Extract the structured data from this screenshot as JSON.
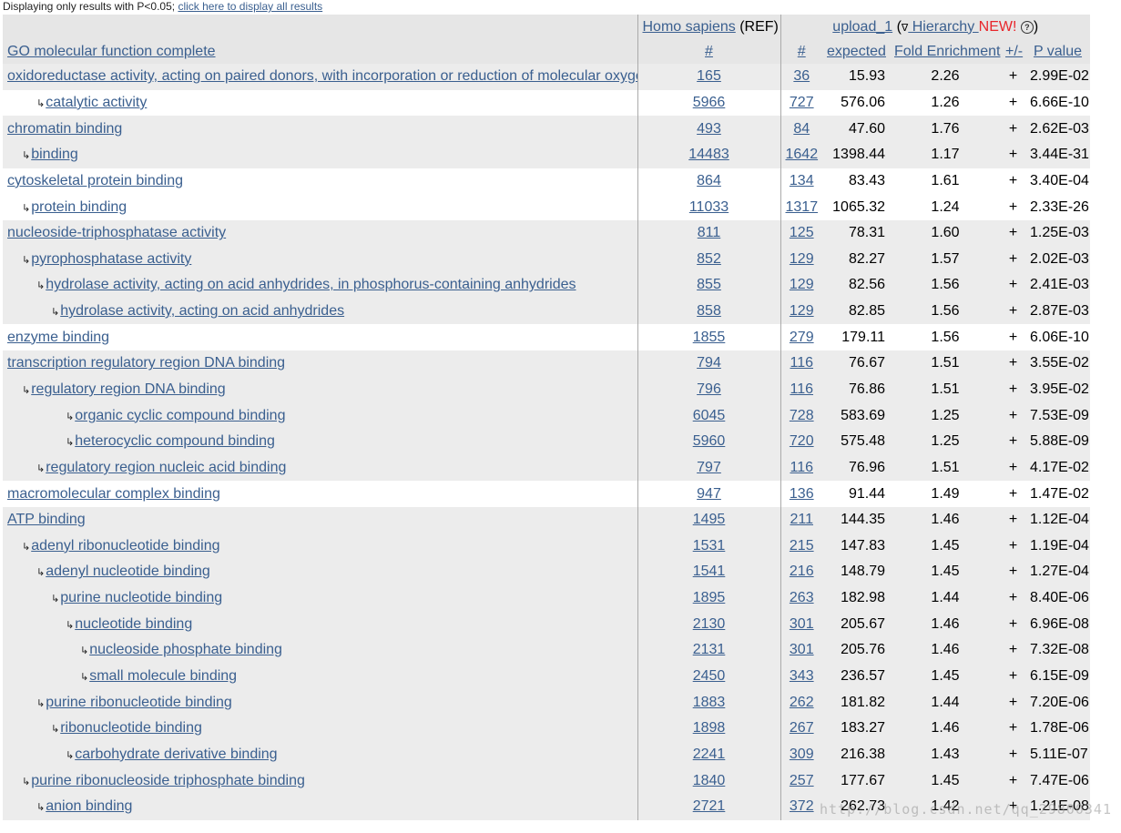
{
  "notice": {
    "text": "Displaying only results with P<0.05; ",
    "link": "click here to display all results"
  },
  "header": {
    "ref_species": "Homo sapiens",
    "ref_suffix": " (REF)",
    "upload": "upload_1",
    "hierarchy_open": " (",
    "hierarchy_tri": "∇",
    "hierarchy_link": " Hierarchy ",
    "new_label": "NEW!",
    "help_icon": "?",
    "hierarchy_close": ")",
    "go_column": "GO molecular function complete",
    "ref_count": "#",
    "count": "#",
    "expected": "expected",
    "fold": "Fold Enrichment",
    "plusminus": "+/-",
    "pvalue": "P value"
  },
  "arrow_glyph": "↳",
  "watermark": "http://blog.csdn.net/qq_29800341",
  "rows": [
    {
      "indent": 0,
      "term": "oxidoreductase activity, acting on paired donors, with incorporation or reduction of molecular oxygen",
      "ref": "165",
      "count": "36",
      "expected": "15.93",
      "fold": "2.26",
      "pm": "+",
      "p": "2.99E-02",
      "shade": true
    },
    {
      "indent": 2,
      "term": "catalytic activity",
      "ref": "5966",
      "count": "727",
      "expected": "576.06",
      "fold": "1.26",
      "pm": "+",
      "p": "6.66E-10",
      "shade": false
    },
    {
      "indent": 0,
      "term": "chromatin binding",
      "ref": "493",
      "count": "84",
      "expected": "47.60",
      "fold": "1.76",
      "pm": "+",
      "p": "2.62E-03",
      "shade": true
    },
    {
      "indent": 1,
      "term": "binding",
      "ref": "14483",
      "count": "1642",
      "expected": "1398.44",
      "fold": "1.17",
      "pm": "+",
      "p": "3.44E-31",
      "shade": true
    },
    {
      "indent": 0,
      "term": "cytoskeletal protein binding",
      "ref": "864",
      "count": "134",
      "expected": "83.43",
      "fold": "1.61",
      "pm": "+",
      "p": "3.40E-04",
      "shade": false
    },
    {
      "indent": 1,
      "term": "protein binding",
      "ref": "11033",
      "count": "1317",
      "expected": "1065.32",
      "fold": "1.24",
      "pm": "+",
      "p": "2.33E-26",
      "shade": false
    },
    {
      "indent": 0,
      "term": "nucleoside-triphosphatase activity",
      "ref": "811",
      "count": "125",
      "expected": "78.31",
      "fold": "1.60",
      "pm": "+",
      "p": "1.25E-03",
      "shade": true
    },
    {
      "indent": 1,
      "term": "pyrophosphatase activity",
      "ref": "852",
      "count": "129",
      "expected": "82.27",
      "fold": "1.57",
      "pm": "+",
      "p": "2.02E-03",
      "shade": true
    },
    {
      "indent": 2,
      "term": "hydrolase activity, acting on acid anhydrides, in phosphorus-containing anhydrides",
      "ref": "855",
      "count": "129",
      "expected": "82.56",
      "fold": "1.56",
      "pm": "+",
      "p": "2.41E-03",
      "shade": true
    },
    {
      "indent": 3,
      "term": "hydrolase activity, acting on acid anhydrides",
      "ref": "858",
      "count": "129",
      "expected": "82.85",
      "fold": "1.56",
      "pm": "+",
      "p": "2.87E-03",
      "shade": true
    },
    {
      "indent": 0,
      "term": "enzyme binding",
      "ref": "1855",
      "count": "279",
      "expected": "179.11",
      "fold": "1.56",
      "pm": "+",
      "p": "6.06E-10",
      "shade": false
    },
    {
      "indent": 0,
      "term": "transcription regulatory region DNA binding",
      "ref": "794",
      "count": "116",
      "expected": "76.67",
      "fold": "1.51",
      "pm": "+",
      "p": "3.55E-02",
      "shade": true
    },
    {
      "indent": 1,
      "term": "regulatory region DNA binding",
      "ref": "796",
      "count": "116",
      "expected": "76.86",
      "fold": "1.51",
      "pm": "+",
      "p": "3.95E-02",
      "shade": true
    },
    {
      "indent": 4,
      "term": "organic cyclic compound binding",
      "ref": "6045",
      "count": "728",
      "expected": "583.69",
      "fold": "1.25",
      "pm": "+",
      "p": "7.53E-09",
      "shade": true
    },
    {
      "indent": 4,
      "term": "heterocyclic compound binding",
      "ref": "5960",
      "count": "720",
      "expected": "575.48",
      "fold": "1.25",
      "pm": "+",
      "p": "5.88E-09",
      "shade": true
    },
    {
      "indent": 2,
      "term": "regulatory region nucleic acid binding",
      "ref": "797",
      "count": "116",
      "expected": "76.96",
      "fold": "1.51",
      "pm": "+",
      "p": "4.17E-02",
      "shade": true
    },
    {
      "indent": 0,
      "term": "macromolecular complex binding",
      "ref": "947",
      "count": "136",
      "expected": "91.44",
      "fold": "1.49",
      "pm": "+",
      "p": "1.47E-02",
      "shade": false
    },
    {
      "indent": 0,
      "term": "ATP binding",
      "ref": "1495",
      "count": "211",
      "expected": "144.35",
      "fold": "1.46",
      "pm": "+",
      "p": "1.12E-04",
      "shade": true
    },
    {
      "indent": 1,
      "term": "adenyl ribonucleotide binding",
      "ref": "1531",
      "count": "215",
      "expected": "147.83",
      "fold": "1.45",
      "pm": "+",
      "p": "1.19E-04",
      "shade": true
    },
    {
      "indent": 2,
      "term": "adenyl nucleotide binding",
      "ref": "1541",
      "count": "216",
      "expected": "148.79",
      "fold": "1.45",
      "pm": "+",
      "p": "1.27E-04",
      "shade": true
    },
    {
      "indent": 3,
      "term": "purine nucleotide binding",
      "ref": "1895",
      "count": "263",
      "expected": "182.98",
      "fold": "1.44",
      "pm": "+",
      "p": "8.40E-06",
      "shade": true
    },
    {
      "indent": 4,
      "term": "nucleotide binding",
      "ref": "2130",
      "count": "301",
      "expected": "205.67",
      "fold": "1.46",
      "pm": "+",
      "p": "6.96E-08",
      "shade": true
    },
    {
      "indent": 5,
      "term": "nucleoside phosphate binding",
      "ref": "2131",
      "count": "301",
      "expected": "205.76",
      "fold": "1.46",
      "pm": "+",
      "p": "7.32E-08",
      "shade": true
    },
    {
      "indent": 5,
      "term": "small molecule binding",
      "ref": "2450",
      "count": "343",
      "expected": "236.57",
      "fold": "1.45",
      "pm": "+",
      "p": "6.15E-09",
      "shade": true
    },
    {
      "indent": 2,
      "term": "purine ribonucleotide binding",
      "ref": "1883",
      "count": "262",
      "expected": "181.82",
      "fold": "1.44",
      "pm": "+",
      "p": "7.20E-06",
      "shade": true
    },
    {
      "indent": 3,
      "term": "ribonucleotide binding",
      "ref": "1898",
      "count": "267",
      "expected": "183.27",
      "fold": "1.46",
      "pm": "+",
      "p": "1.78E-06",
      "shade": true
    },
    {
      "indent": 4,
      "term": "carbohydrate derivative binding",
      "ref": "2241",
      "count": "309",
      "expected": "216.38",
      "fold": "1.43",
      "pm": "+",
      "p": "5.11E-07",
      "shade": true
    },
    {
      "indent": 1,
      "term": "purine ribonucleoside triphosphate binding",
      "ref": "1840",
      "count": "257",
      "expected": "177.67",
      "fold": "1.45",
      "pm": "+",
      "p": "7.47E-06",
      "shade": true
    },
    {
      "indent": 2,
      "term": "anion binding",
      "ref": "2721",
      "count": "372",
      "expected": "262.73",
      "fold": "1.42",
      "pm": "+",
      "p": "1.21E-08",
      "shade": true
    }
  ]
}
